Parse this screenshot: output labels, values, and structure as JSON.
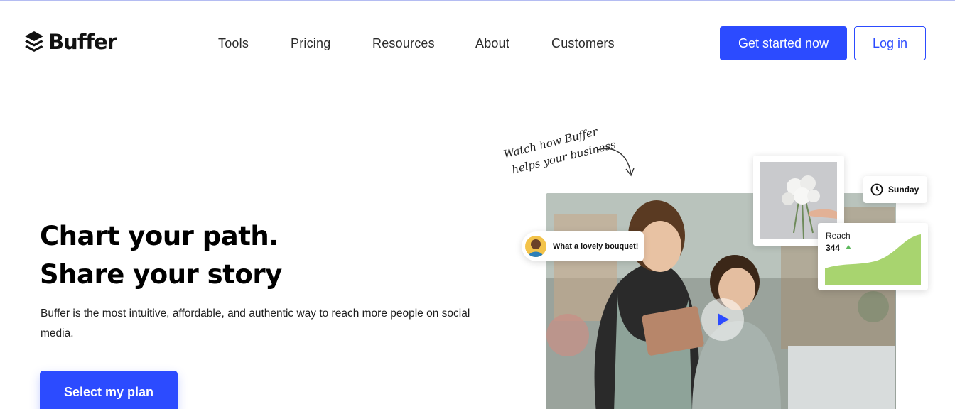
{
  "brand": {
    "name": "Buffer"
  },
  "nav": {
    "items": [
      {
        "label": "Tools"
      },
      {
        "label": "Pricing"
      },
      {
        "label": "Resources"
      },
      {
        "label": "About"
      },
      {
        "label": "Customers"
      }
    ]
  },
  "header": {
    "cta_label": "Get started now",
    "login_label": "Log in"
  },
  "hero": {
    "title_line1": "Chart your path.",
    "title_line2": "Share your story",
    "description": "Buffer is the most intuitive, affordable, and authentic way to reach more people on social media.",
    "plan_button": "Select my plan"
  },
  "visual": {
    "handwritten_line1": "Watch how Buffer",
    "handwritten_line2": "helps your business",
    "comment": "What a lovely bouquet!",
    "schedule_day": "Sunday",
    "reach_label": "Reach",
    "reach_value": "344"
  },
  "colors": {
    "accent": "#2c4bff",
    "chart_green": "#a8d46f",
    "up_arrow": "#5cb85c"
  },
  "icons": [
    "buffer-logo-icon",
    "play-icon",
    "clock-icon",
    "up-triangle-icon",
    "curved-arrow-icon"
  ]
}
